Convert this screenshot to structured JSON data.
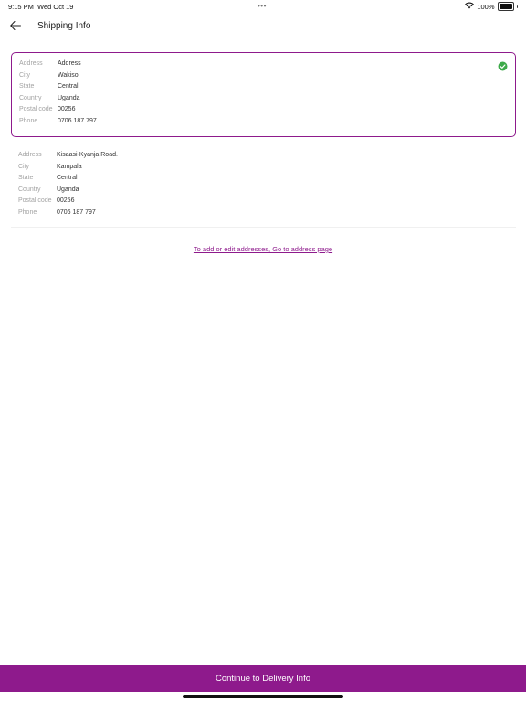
{
  "status_bar": {
    "time": "9:15 PM",
    "date": "Wed Oct 19",
    "battery_text": "100%",
    "battery_level": 1.0,
    "icons": [
      "wifi-icon",
      "battery-icon"
    ]
  },
  "header": {
    "title": "Shipping Info",
    "back_icon": "arrow-left-icon"
  },
  "addresses": [
    {
      "selected": true,
      "fields": [
        {
          "label": "Address",
          "value": "Address"
        },
        {
          "label": "City",
          "value": "Wakiso"
        },
        {
          "label": "State",
          "value": "Central"
        },
        {
          "label": "Country",
          "value": "Uganda"
        },
        {
          "label": "Postal code",
          "value": "00256"
        },
        {
          "label": "Phone",
          "value": "0706 187 797"
        }
      ],
      "badge_icon": "check-circle-icon"
    },
    {
      "selected": false,
      "fields": [
        {
          "label": "Address",
          "value": "Kisaasi-Kyanja Road."
        },
        {
          "label": "City",
          "value": "Kampala"
        },
        {
          "label": "State",
          "value": "Central"
        },
        {
          "label": "Country",
          "value": "Uganda"
        },
        {
          "label": "Postal code",
          "value": "00256"
        },
        {
          "label": "Phone",
          "value": "0706 187 797"
        }
      ]
    }
  ],
  "address_link": {
    "text": "To add or edit addresses, Go to address page"
  },
  "footer": {
    "continue_label": "Continue to Delivery Info"
  },
  "colors": {
    "accent": "#8e1a8c",
    "check_green": "#3daa4a",
    "label_gray": "#a3a3a3"
  }
}
